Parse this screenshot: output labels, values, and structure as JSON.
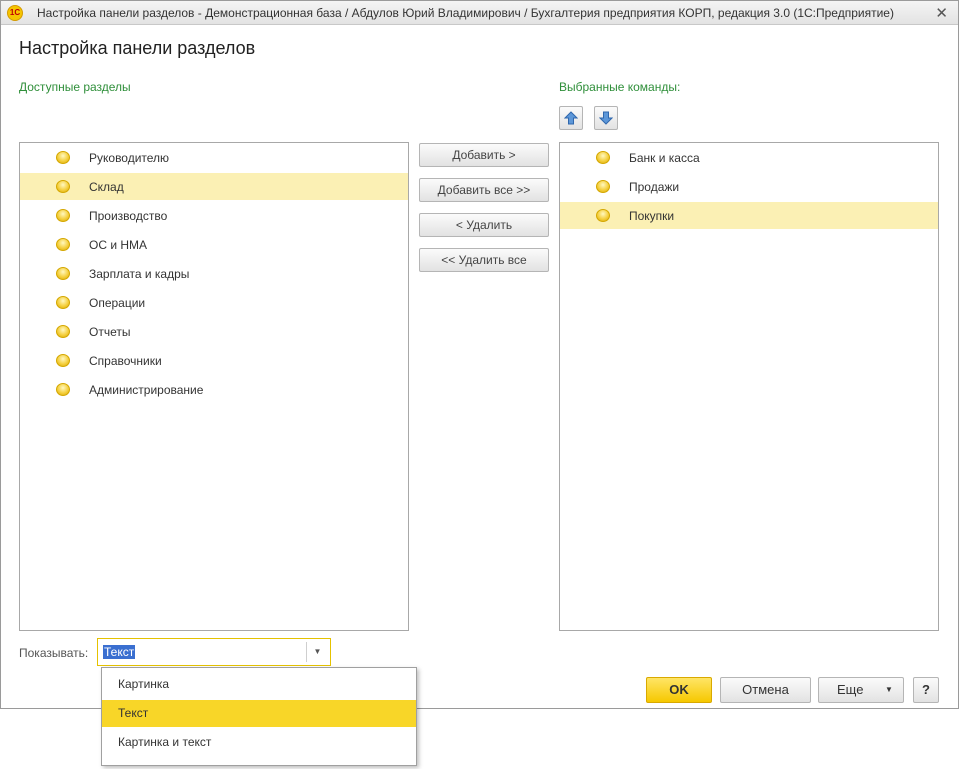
{
  "window": {
    "title": "Настройка панели разделов - Демонстрационная база / Абдулов Юрий Владимирович / Бухгалтерия предприятия КОРП, редакция 3.0  (1С:Предприятие)",
    "logo_text": "1С",
    "close_label": "✕"
  },
  "heading": "Настройка панели разделов",
  "available": {
    "label": "Доступные разделы",
    "items": [
      {
        "label": "Руководителю",
        "selected": false
      },
      {
        "label": "Склад",
        "selected": true
      },
      {
        "label": "Производство",
        "selected": false
      },
      {
        "label": "ОС и НМА",
        "selected": false
      },
      {
        "label": "Зарплата и кадры",
        "selected": false
      },
      {
        "label": "Операции",
        "selected": false
      },
      {
        "label": "Отчеты",
        "selected": false
      },
      {
        "label": "Справочники",
        "selected": false
      },
      {
        "label": "Администрирование",
        "selected": false
      }
    ]
  },
  "selected_commands": {
    "label": "Выбранные команды:",
    "items": [
      {
        "label": "Банк и касса",
        "selected": false
      },
      {
        "label": "Продажи",
        "selected": false
      },
      {
        "label": "Покупки",
        "selected": true
      }
    ]
  },
  "actions": {
    "add": "Добавить >",
    "add_all": "Добавить все >>",
    "remove": "< Удалить",
    "remove_all": "<< Удалить все"
  },
  "show": {
    "label": "Показывать:",
    "value": "Текст",
    "drop_arrow": "▼",
    "options": [
      {
        "label": "Картинка",
        "selected": false
      },
      {
        "label": "Текст",
        "selected": true
      },
      {
        "label": "Картинка и текст",
        "selected": false
      }
    ]
  },
  "footer": {
    "ok": "OK",
    "cancel": "Отмена",
    "more": "Еще",
    "more_arrow": "▼",
    "help": "?"
  },
  "colors": {
    "accent_green": "#2f8f3a",
    "selection_row": "#fbf0b4",
    "dropdown_selection": "#f8d628",
    "ok_button": "#f6c800"
  }
}
